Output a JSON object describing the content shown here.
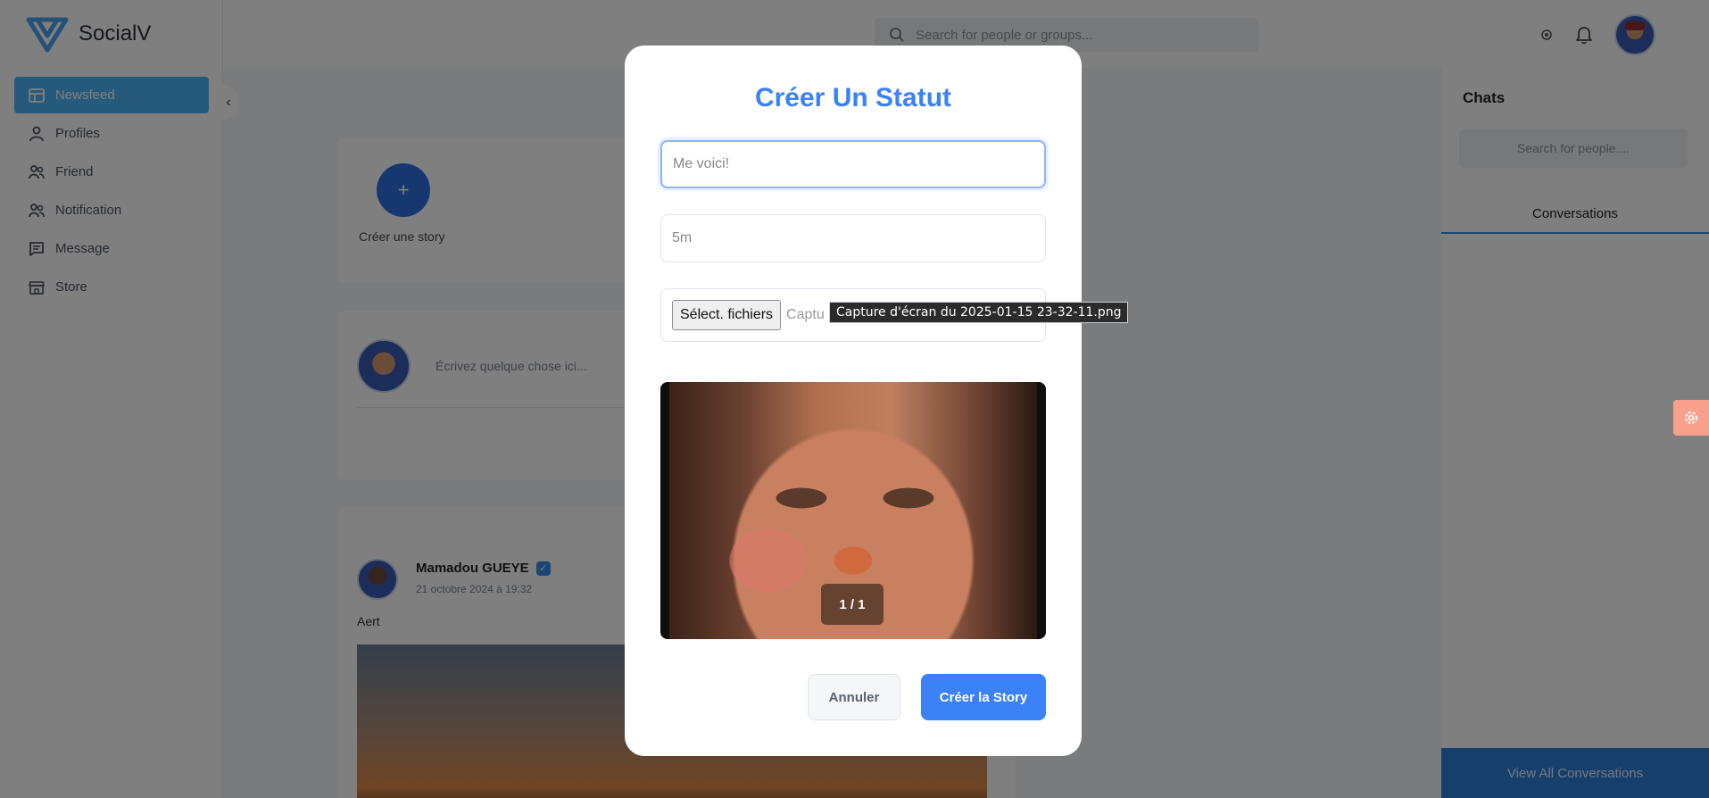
{
  "app": {
    "name": "SocialV"
  },
  "sidebar": {
    "items": [
      {
        "label": "Newsfeed",
        "icon": "newsfeed-icon",
        "active": true
      },
      {
        "label": "Profiles",
        "icon": "person-icon",
        "active": false
      },
      {
        "label": "Friend",
        "icon": "friends-icon",
        "active": false
      },
      {
        "label": "Notification",
        "icon": "friends-icon",
        "active": false
      },
      {
        "label": "Message",
        "icon": "message-icon",
        "active": false
      },
      {
        "label": "Store",
        "icon": "store-icon",
        "active": false
      }
    ]
  },
  "header": {
    "search_placeholder": "Search for people or groups..."
  },
  "feed": {
    "story_label": "Créer une story",
    "post_placeholder": "Écrivez quelque chose ici...",
    "post": {
      "author": "Mamadou GUEYE",
      "date": "21 octobre 2024 à 19:32",
      "text": "Aert"
    }
  },
  "chats": {
    "title": "Chats",
    "search_placeholder": "Search for people....",
    "tab": "Conversations",
    "footer": "View All Conversations"
  },
  "modal": {
    "title": "Créer Un Statut",
    "caption_value": "Me voici!",
    "duration_value": "5m",
    "file_button": "Sélect. fichiers",
    "file_name_truncated": "Captu",
    "tooltip": "Capture d'écran du 2025-01-15 23-32-11.png",
    "counter": "1 / 1",
    "cancel_label": "Annuler",
    "create_label": "Créer la Story"
  },
  "colors": {
    "accent": "#3b82f6",
    "sidebar_active": "#4cb5f9"
  }
}
